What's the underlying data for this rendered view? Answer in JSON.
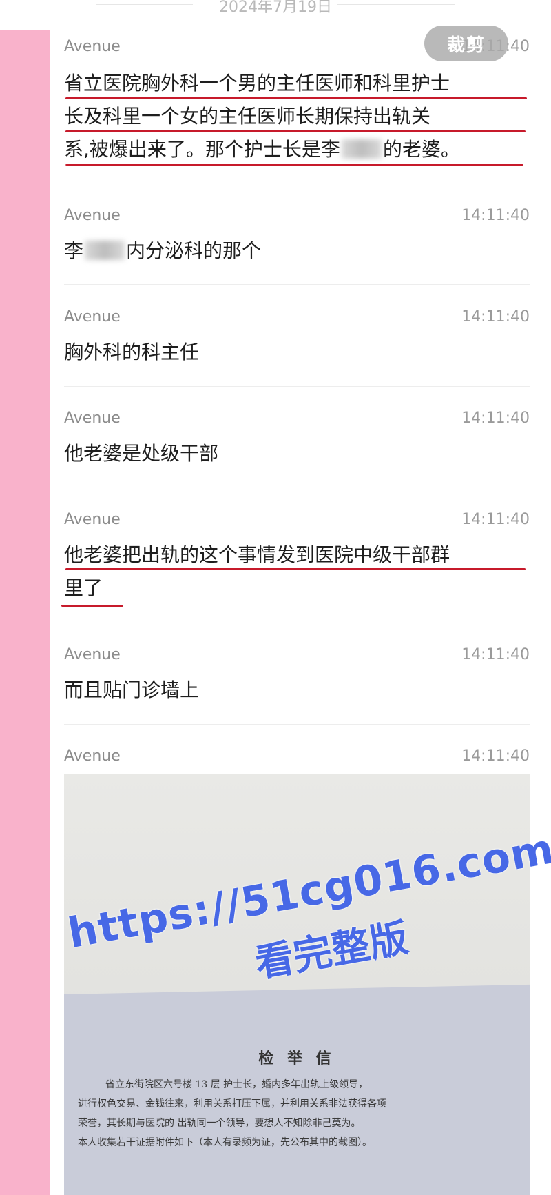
{
  "date_header": "2024年7月19日",
  "crop_button": "裁剪",
  "messages": [
    {
      "sender": "Avenue",
      "time": "14:11:40",
      "lines": [
        "省立医院胸外科一个男的主任医师和科里护士",
        "长及科里一个女的主任医师长期保持出轨关",
        "系,被爆出来了。那个护士长是李",
        "的老婆。"
      ]
    },
    {
      "sender": "Avenue",
      "time": "14:11:40",
      "pre": "李",
      "post": "内分泌科的那个"
    },
    {
      "sender": "Avenue",
      "time": "14:11:40",
      "text": "胸外科的科主任"
    },
    {
      "sender": "Avenue",
      "time": "14:11:40",
      "text": "他老婆是处级干部"
    },
    {
      "sender": "Avenue",
      "time": "14:11:40",
      "lines": [
        "他老婆把出轨的这个事情发到医院中级干部群",
        "里了"
      ]
    },
    {
      "sender": "Avenue",
      "time": "14:11:40",
      "text": "而且贴门诊墙上"
    },
    {
      "sender": "Avenue",
      "time": "14:11:40"
    }
  ],
  "photo": {
    "title": "检 举 信",
    "lines": [
      "省立东街院区六号楼 13 层          护士长，婚内多年出轨上级领导，",
      "进行权色交易、金钱往来，利用关系打压下属，并利用关系非法获得各项",
      "荣誉，其长期与医院的          出轨同一个领导，要想人不知除非己莫为。",
      "本人收集若干证据附件如下（本人有录频为证，先公布其中的截图）。"
    ]
  },
  "watermark": {
    "url": "https://51cg016.com",
    "sub": "看完整版"
  },
  "colors": {
    "accent_pink": "#f9b2cb",
    "underline_red": "#c71a2b",
    "watermark_blue": "#4768e6"
  }
}
